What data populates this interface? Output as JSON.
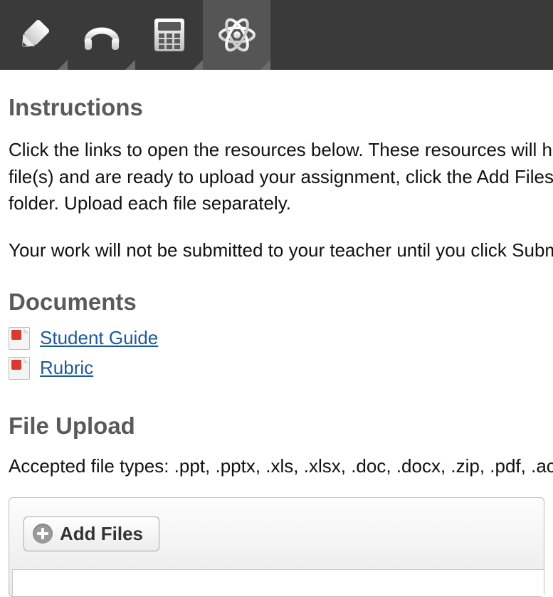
{
  "toolbar": {
    "tools": [
      {
        "name": "pencil-icon"
      },
      {
        "name": "headphones-icon"
      },
      {
        "name": "calculator-icon"
      },
      {
        "name": "atom-icon"
      }
    ]
  },
  "instructions": {
    "heading": "Instructions",
    "line1": "Click the links to open the resources below. These resources will help y",
    "line2": "file(s) and are ready to upload your assignment, click the Add Files but",
    "line3": "folder. Upload each file separately.",
    "line4": "Your work will not be submitted to your teacher until you click Submit."
  },
  "documents": {
    "heading": "Documents",
    "items": [
      {
        "label": "Student Guide"
      },
      {
        "label": "Rubric"
      }
    ]
  },
  "upload": {
    "heading": "File Upload",
    "accepted": "Accepted file types: .ppt, .pptx, .xls, .xlsx, .doc, .docx, .zip, .pdf, .accd",
    "add_files_label": "Add Files"
  }
}
